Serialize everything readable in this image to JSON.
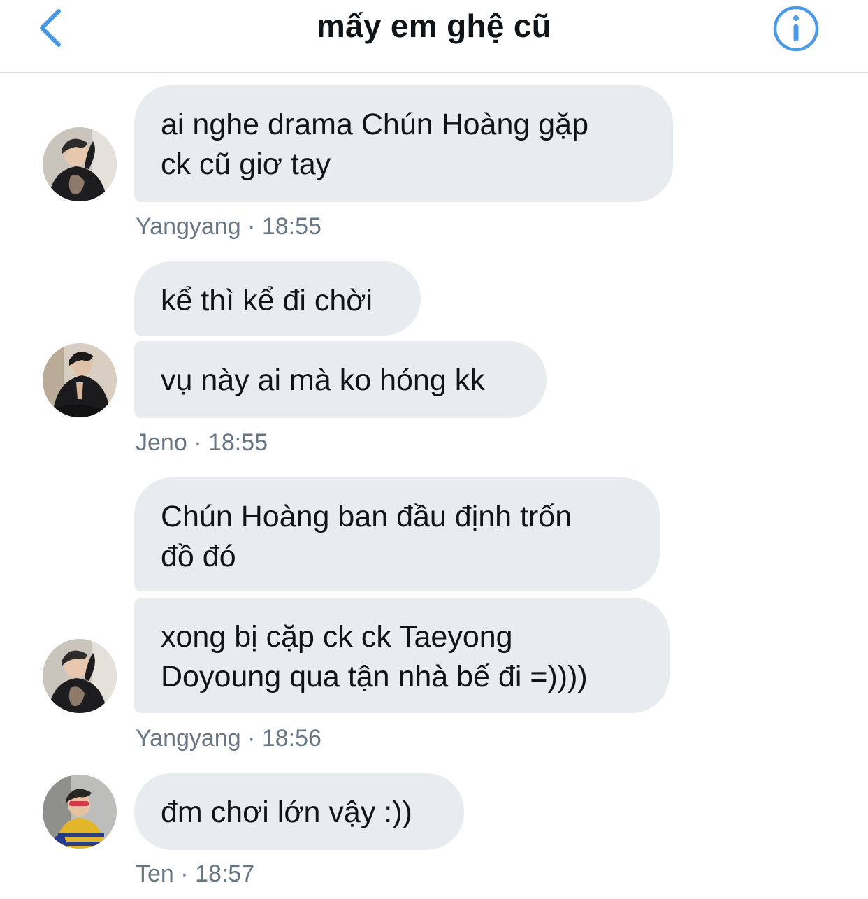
{
  "header": {
    "title": "mấy em ghệ cũ",
    "accent_color": "#4a9ae6"
  },
  "messages": [
    {
      "bubbles": [
        {
          "lines": [
            "ai nghe drama Chún Hoàng gặp",
            "ck cũ giơ tay"
          ]
        }
      ],
      "sender": "Yangyang",
      "time": "18:55",
      "avatar": "yangyang-avatar"
    },
    {
      "bubbles": [
        {
          "lines": [
            "kể thì kể đi chời"
          ]
        },
        {
          "lines": [
            "vụ này ai mà ko hóng kk"
          ]
        }
      ],
      "sender": "Jeno",
      "time": "18:55",
      "avatar": "jeno-avatar"
    },
    {
      "bubbles": [
        {
          "lines": [
            "Chún Hoàng ban đầu định trốn",
            "đồ đó"
          ]
        },
        {
          "lines": [
            "xong bị cặp ck ck Taeyong",
            "Doyoung qua tận nhà bế đi =))))"
          ]
        }
      ],
      "sender": "Yangyang",
      "time": "18:56",
      "avatar": "yangyang-avatar"
    },
    {
      "bubbles": [
        {
          "lines": [
            "đm chơi lớn vậy :))"
          ]
        }
      ],
      "sender": "Ten",
      "time": "18:57",
      "avatar": "ten-avatar"
    }
  ],
  "meta_separator": "·"
}
